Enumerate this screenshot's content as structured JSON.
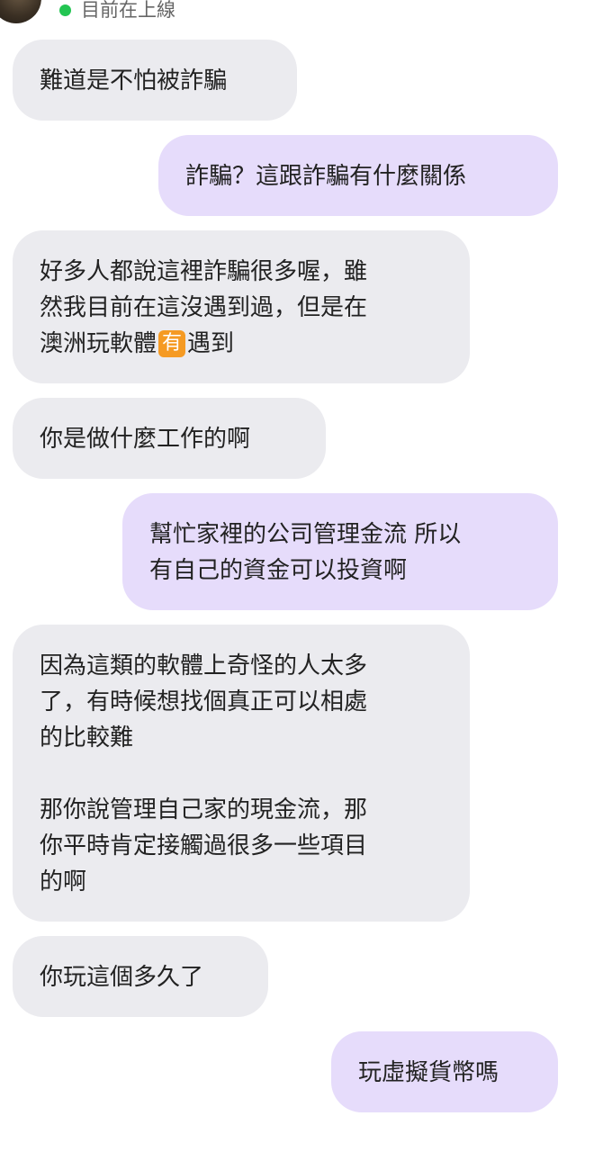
{
  "header": {
    "status": "目前在上線"
  },
  "messages": [
    {
      "side": "in",
      "text": "難道是不怕被詐騙"
    },
    {
      "side": "out",
      "text": "詐騙？這跟詐騙有什麼關係"
    },
    {
      "side": "in",
      "text_before": "好多人都說這裡詐騙很多喔，雖\n然我目前在這沒遇到過，但是在\n澳洲玩軟體",
      "emoji": "有",
      "text_after": "遇到"
    },
    {
      "side": "in",
      "text": "你是做什麼工作的啊"
    },
    {
      "side": "out",
      "text": "幫忙家裡的公司管理金流 所以\n有自己的資金可以投資啊"
    },
    {
      "side": "in",
      "text": "因為這類的軟體上奇怪的人太多\n了，有時候想找個真正可以相處\n的比較難\n\n那你說管理自己家的現金流，那\n你平時肯定接觸過很多一些項目\n的啊"
    },
    {
      "side": "in",
      "text": "你玩這個多久了"
    },
    {
      "side": "out",
      "text": "玩虛擬貨幣嗎"
    }
  ],
  "colors": {
    "incoming_bubble": "#ebebef",
    "outgoing_bubble": "#e6dcfb",
    "online_dot": "#23c552",
    "emoji_badge": "#f59a23"
  }
}
